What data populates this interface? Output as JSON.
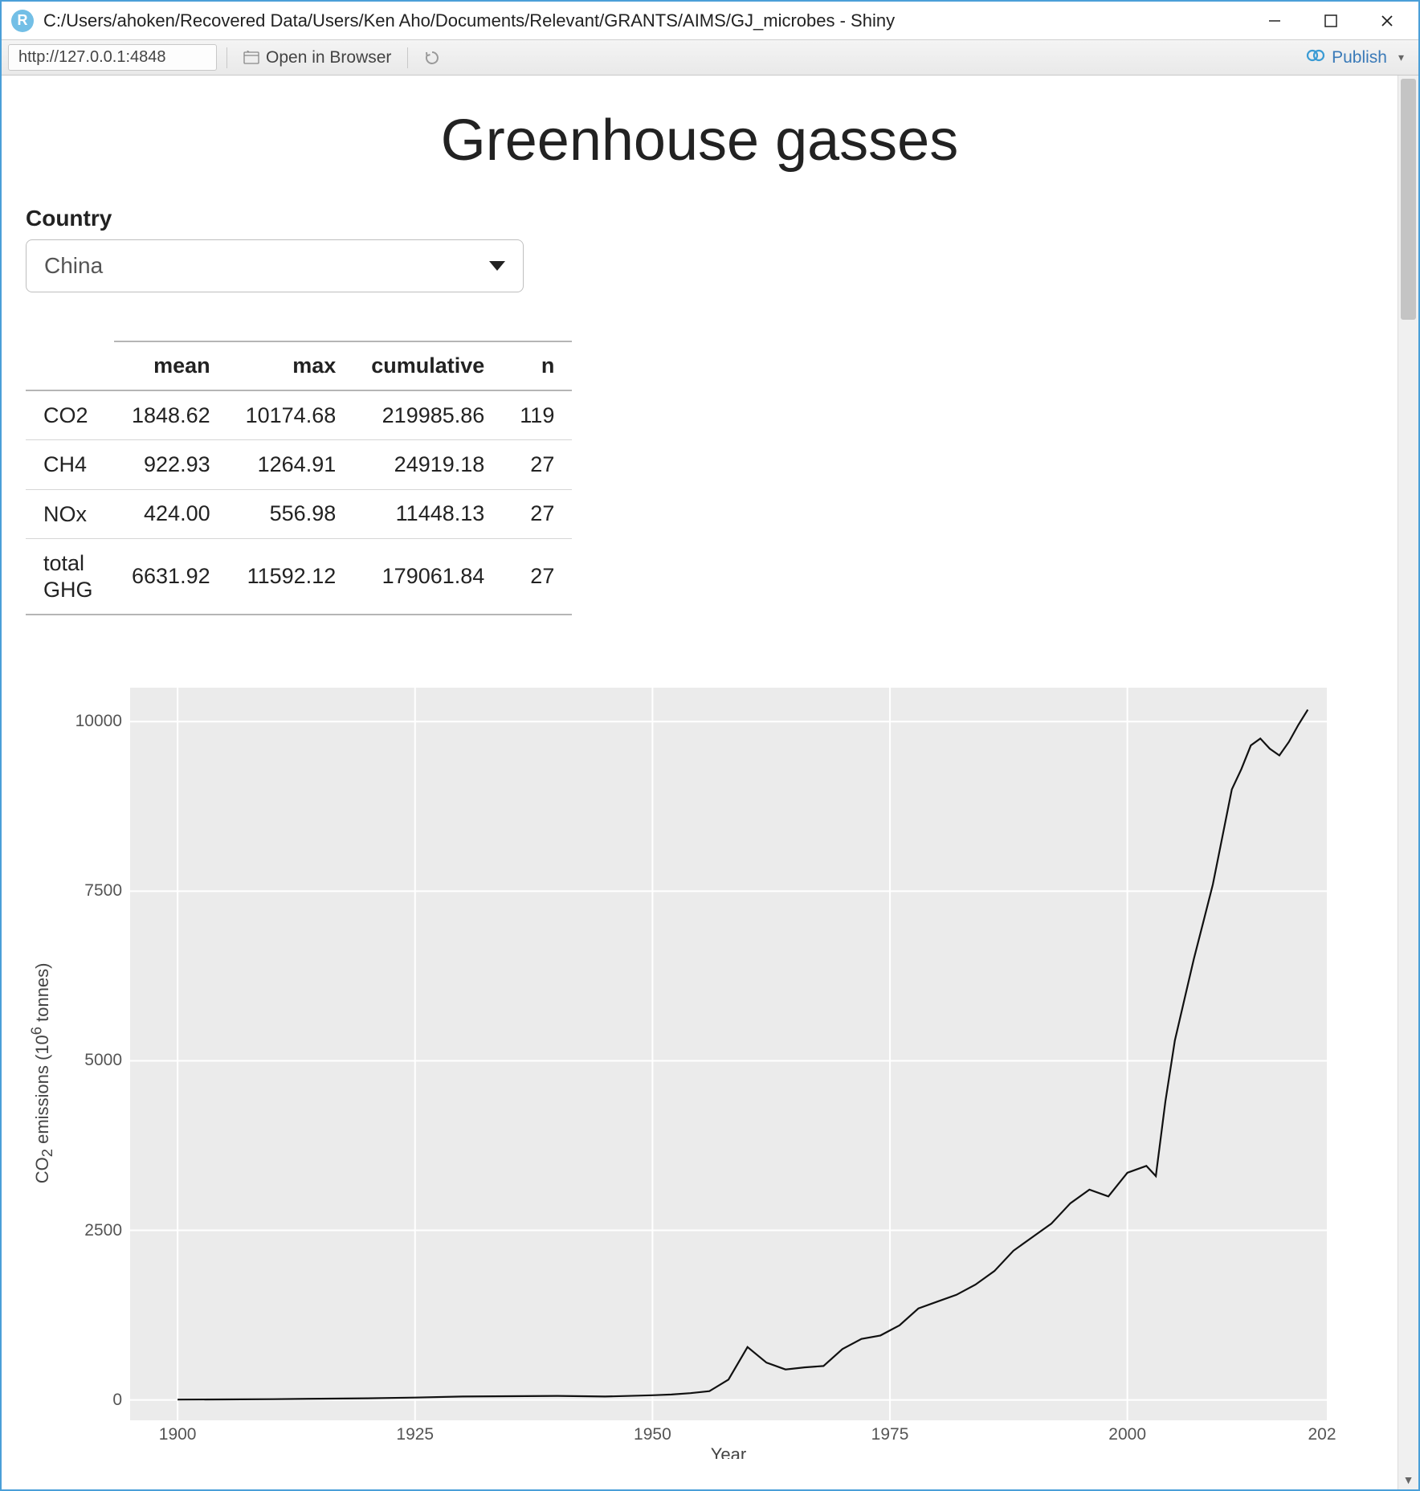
{
  "window": {
    "title": "C:/Users/ahoken/Recovered Data/Users/Ken Aho/Documents/Relevant/GRANTS/AIMS/GJ_microbes - Shiny"
  },
  "toolbar": {
    "url": "http://127.0.0.1:4848",
    "open_label": "Open in Browser",
    "publish_label": "Publish"
  },
  "page": {
    "title": "Greenhouse gasses",
    "country_label": "Country",
    "country_value": "China"
  },
  "table": {
    "headers": [
      "",
      "mean",
      "max",
      "cumulative",
      "n"
    ],
    "rows": [
      {
        "label": "CO2",
        "mean": "1848.62",
        "max": "10174.68",
        "cumulative": "219985.86",
        "n": "119"
      },
      {
        "label": "CH4",
        "mean": "922.93",
        "max": "1264.91",
        "cumulative": "24919.18",
        "n": "27"
      },
      {
        "label": "NOx",
        "mean": "424.00",
        "max": "556.98",
        "cumulative": "11448.13",
        "n": "27"
      },
      {
        "label": "total GHG",
        "mean": "6631.92",
        "max": "11592.12",
        "cumulative": "179061.84",
        "n": "27"
      }
    ]
  },
  "chart_data": {
    "type": "line",
    "title": "",
    "xlabel": "Year",
    "ylabel_html": "CO<sub>2</sub> emissions (10<sup>6</sup> tonnes)",
    "xlim": [
      1895,
      2021
    ],
    "ylim": [
      -300,
      10500
    ],
    "x_ticks": [
      1900,
      1925,
      1950,
      1975,
      2000
    ],
    "y_ticks": [
      0,
      2500,
      5000,
      7500,
      10000
    ],
    "x_last_tick_label": "202",
    "x": [
      1900,
      1905,
      1910,
      1915,
      1920,
      1925,
      1930,
      1935,
      1940,
      1945,
      1950,
      1952,
      1954,
      1956,
      1958,
      1960,
      1962,
      1964,
      1966,
      1968,
      1970,
      1972,
      1974,
      1976,
      1978,
      1980,
      1982,
      1984,
      1986,
      1988,
      1990,
      1992,
      1994,
      1996,
      1998,
      2000,
      2002,
      2003,
      2004,
      2005,
      2006,
      2007,
      2008,
      2009,
      2010,
      2011,
      2012,
      2013,
      2014,
      2015,
      2016,
      2017,
      2018,
      2019
    ],
    "y": [
      5,
      8,
      12,
      18,
      25,
      35,
      50,
      55,
      60,
      50,
      70,
      80,
      100,
      130,
      300,
      780,
      550,
      450,
      480,
      500,
      750,
      900,
      950,
      1100,
      1350,
      1450,
      1550,
      1700,
      1900,
      2200,
      2400,
      2600,
      2900,
      3100,
      3000,
      3350,
      3450,
      3300,
      4400,
      5300,
      5900,
      6500,
      7050,
      7600,
      8300,
      9000,
      9300,
      9650,
      9750,
      9600,
      9500,
      9700,
      9950,
      10175
    ]
  }
}
